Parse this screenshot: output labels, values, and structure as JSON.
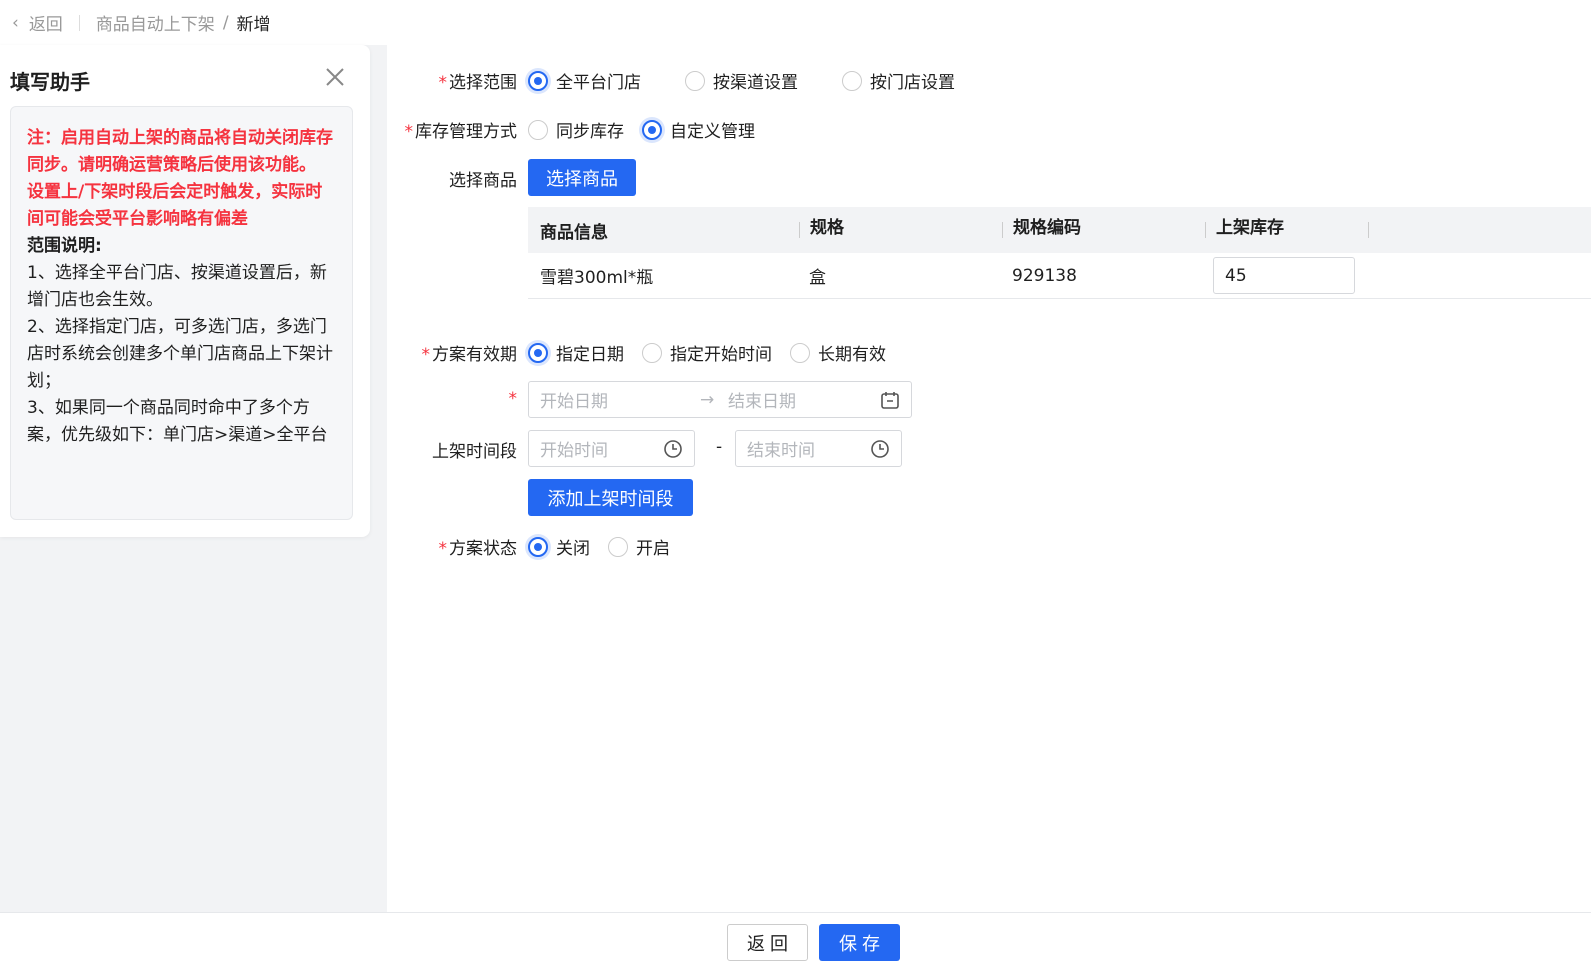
{
  "breadcrumb": {
    "back": "返回",
    "parent": "商品自动上下架",
    "sep": "/",
    "current": "新增"
  },
  "helper": {
    "title": "填写助手",
    "note_red": [
      "注：启用自动上架的商品将自动关闭库存同步。请明确运营策略后使用该功能。",
      "设置上/下架时段后会定时触发，实际时间可能会受平台影响略有偏差"
    ],
    "scope_title": "范围说明:",
    "scope_items": [
      "1、选择全平台门店、按渠道设置后，新增门店也会生效。",
      "2、选择指定门店，可多选门店，多选门店时系统会创建多个单门店商品上下架计划；",
      "3、如果同一个商品同时命中了多个方案，优先级如下：单门店>渠道>全平台"
    ]
  },
  "form": {
    "scope": {
      "label": "选择范围",
      "options": [
        "全平台门店",
        "按渠道设置",
        "按门店设置"
      ],
      "selected": 0
    },
    "stock": {
      "label": "库存管理方式",
      "options": [
        "同步库存",
        "自定义管理"
      ],
      "selected": 1
    },
    "goods": {
      "label": "选择商品",
      "button": "选择商品"
    },
    "table": {
      "columns": [
        "商品信息",
        "规格",
        "规格编码",
        "上架库存"
      ],
      "rows": [
        {
          "name": "雪碧300ml*瓶",
          "spec": "盒",
          "code": "929138",
          "stock": "45"
        }
      ]
    },
    "validity": {
      "label": "方案有效期",
      "options": [
        "指定日期",
        "指定开始时间",
        "长期有效"
      ],
      "selected": 0,
      "start_placeholder": "开始日期",
      "end_placeholder": "结束日期",
      "arrow": "→"
    },
    "period": {
      "label": "上架时间段",
      "start_placeholder": "开始时间",
      "end_placeholder": "结束时间",
      "dash": "-",
      "add_button": "添加上架时间段"
    },
    "status": {
      "label": "方案状态",
      "options": [
        "关闭",
        "开启"
      ],
      "selected": 0
    }
  },
  "footer": {
    "back": "返 回",
    "save": "保 存"
  },
  "colors": {
    "primary": "#2468f2",
    "danger": "#f5333f"
  }
}
